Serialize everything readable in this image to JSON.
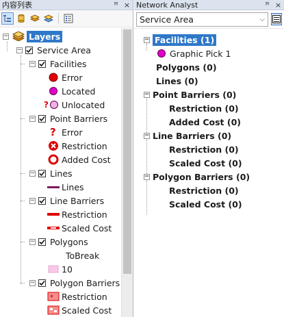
{
  "toc": {
    "title": "内容列表",
    "pin_glyph": "ꟸ",
    "close_glyph": "×",
    "toolbar": [
      "list-by-drawing-order-icon",
      "list-by-source-icon",
      "list-by-visibility-icon",
      "list-by-selection-icon",
      "options-icon"
    ],
    "items": {
      "layers": "Layers",
      "service_area": "Service Area",
      "facilities": "Facilities",
      "error1": "Error",
      "located": "Located",
      "unlocated": "Unlocated",
      "point_barriers": "Point Barriers",
      "error2": "Error",
      "restriction1": "Restriction",
      "added_cost": "Added Cost",
      "lines": "Lines",
      "lines_sym": "Lines",
      "line_barriers": "Line Barriers",
      "restriction2": "Restriction",
      "scaled_cost1": "Scaled Cost",
      "polygons": "Polygons",
      "tobreak": "ToBreak",
      "ten": "10",
      "polygon_barriers": "Polygon Barriers",
      "restriction3": "Restriction",
      "scaled_cost2": "Scaled Cost"
    }
  },
  "na": {
    "title": "Network Analyst",
    "combo_value": "Service Area",
    "items": {
      "facilities": "Facilities (1)",
      "graphic_pick": "Graphic Pick 1",
      "polygons": "Polygons (0)",
      "lines": "Lines (0)",
      "point_barriers": "Point Barriers (0)",
      "pb_restriction": "Restriction (0)",
      "pb_added_cost": "Added Cost (0)",
      "line_barriers": "Line Barriers (0)",
      "lb_restriction": "Restriction (0)",
      "lb_scaled_cost": "Scaled Cost (0)",
      "polygon_barriers": "Polygon Barriers (0)",
      "gb_restriction": "Restriction (0)",
      "gb_scaled_cost": "Scaled Cost (0)"
    }
  },
  "colors": {
    "selection": "#2e78c9",
    "error_red": "#e00000",
    "located_magenta": "#e000c8",
    "unlocated_pink": "#f0b0e6",
    "line_purple": "#7a1a5e",
    "polygon_pink": "#f8c8e8"
  }
}
